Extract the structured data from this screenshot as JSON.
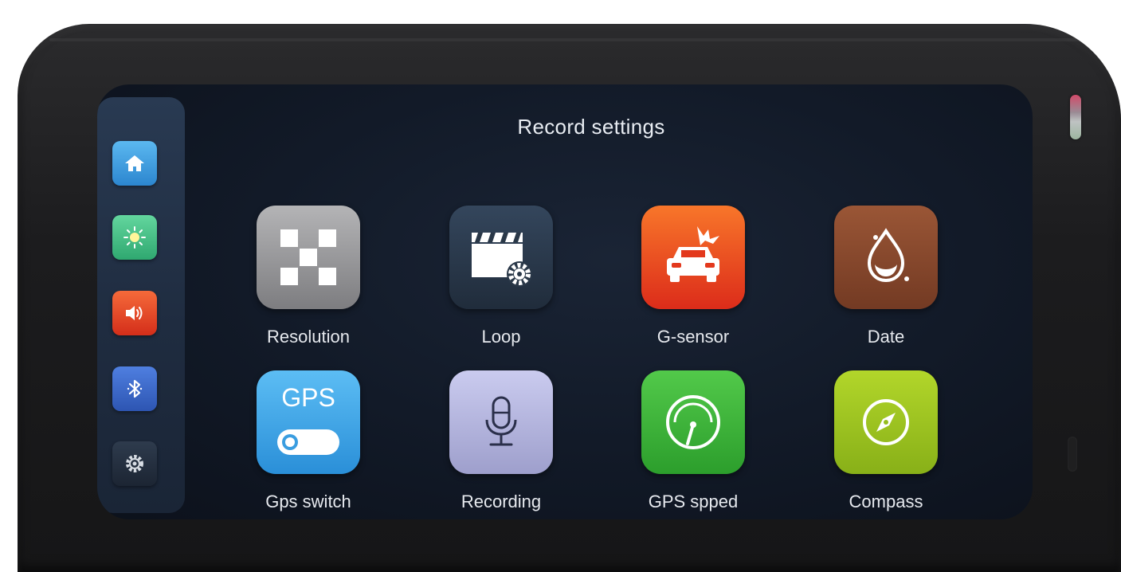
{
  "screen": {
    "title": "Record settings"
  },
  "sidebar": {
    "items": [
      {
        "icon": "home-icon",
        "color": "#3e9fe0"
      },
      {
        "icon": "brightness-icon",
        "color": "#4cc28b"
      },
      {
        "icon": "volume-icon",
        "color": "#e8452a"
      },
      {
        "icon": "bluetooth-icon",
        "color": "#3a66c8"
      },
      {
        "icon": "settings-icon",
        "color": "#24303f"
      }
    ]
  },
  "tiles": [
    {
      "label": "Resolution",
      "icon": "resolution-icon",
      "color": "#9a9a9c"
    },
    {
      "label": "Loop",
      "icon": "loop-video-icon",
      "color": "#2c3a4c"
    },
    {
      "label": "G-sensor",
      "icon": "car-crash-icon",
      "color": "#e8461f"
    },
    {
      "label": "Date",
      "icon": "droplet-icon",
      "color": "#8a4b2e"
    },
    {
      "label": "Gps switch",
      "icon": "gps-toggle-icon",
      "color": "#3ea8ea",
      "badge": "GPS"
    },
    {
      "label": "Recording",
      "icon": "microphone-icon",
      "color": "#b6b8dc"
    },
    {
      "label": "GPS spped",
      "icon": "speedometer-icon",
      "color": "#3db33a"
    },
    {
      "label": "Compass",
      "icon": "compass-icon",
      "color": "#9dc21f"
    }
  ]
}
